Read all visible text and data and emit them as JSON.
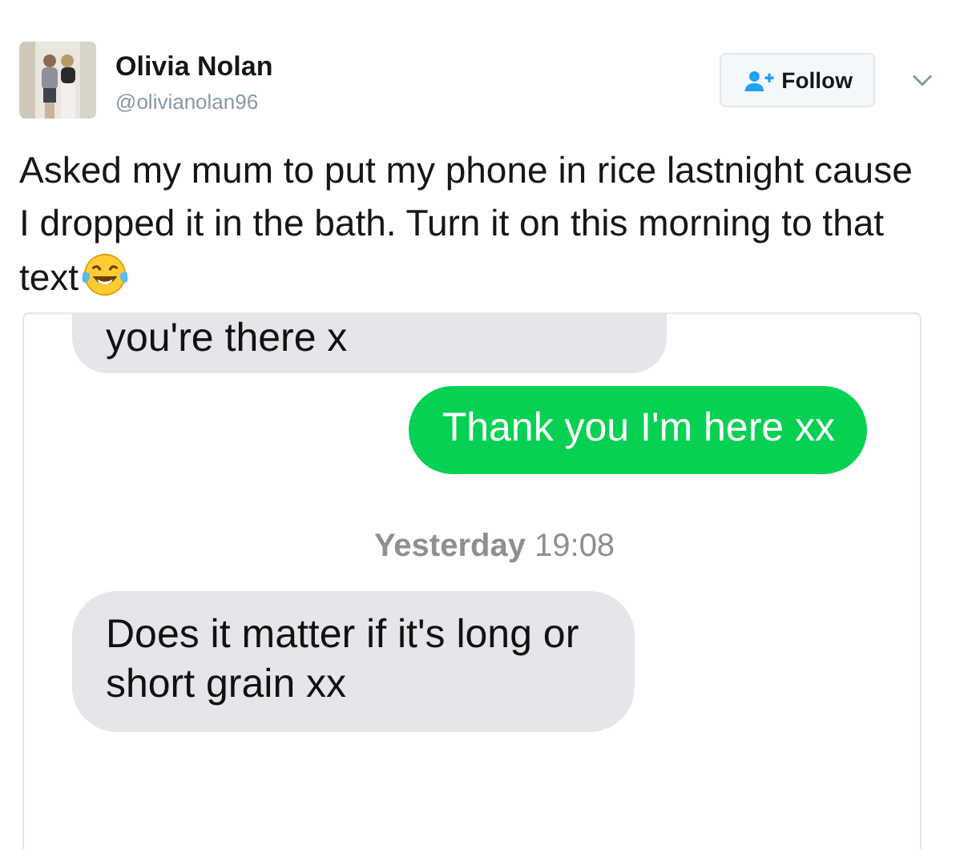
{
  "tweet": {
    "author": {
      "name": "Olivia Nolan",
      "handle": "@olivianolan96"
    },
    "follow_button": {
      "label": "Follow"
    },
    "text": "Asked my mum to put my phone in rice lastnight cause I dropped it in the bath. Turn it on this morning to that text",
    "messages": [
      {
        "kind": "incoming",
        "text": "you're there x"
      },
      {
        "kind": "outgoing",
        "text": "Thank you I'm here xx"
      },
      {
        "kind": "timestamp",
        "text": "**Yesterday** 19:08"
      },
      {
        "kind": "incoming",
        "text": "Does it matter if it's long or short grain xx"
      }
    ]
  }
}
